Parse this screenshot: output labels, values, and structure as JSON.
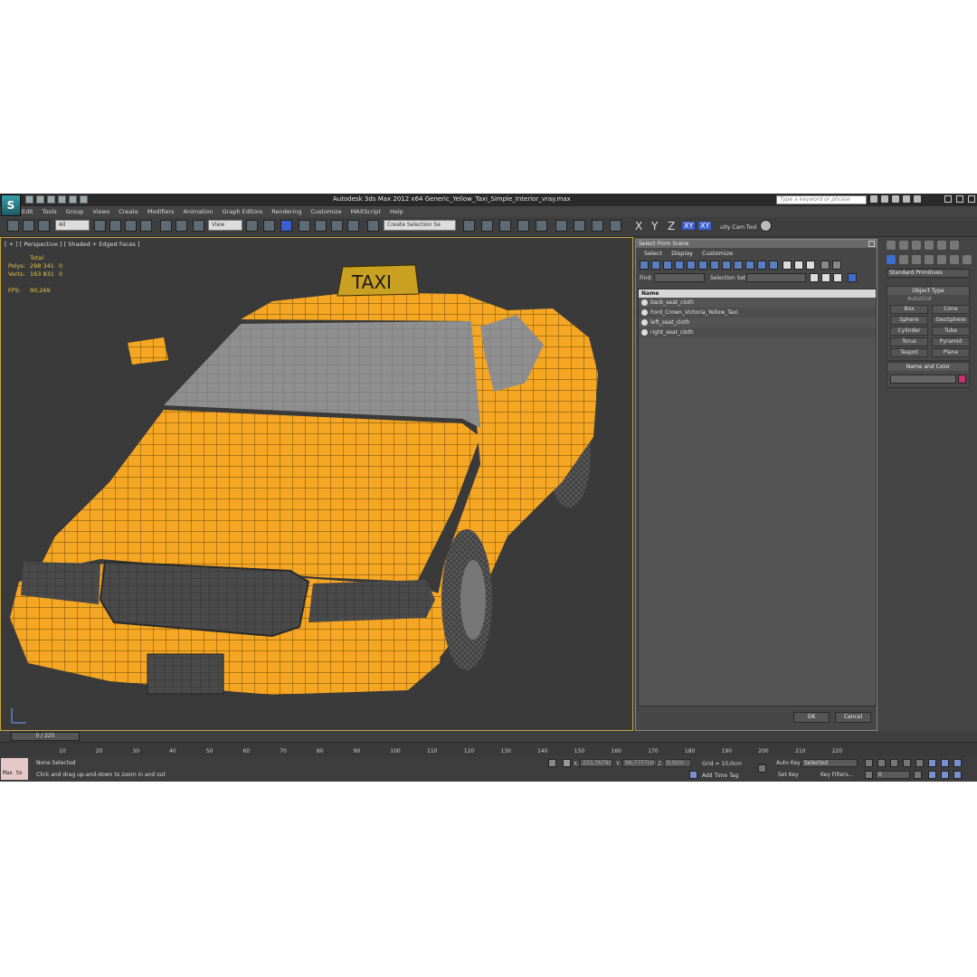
{
  "app": {
    "title": "Autodesk 3ds Max  2012 x64     Generic_Yellow_Taxi_Simple_Interior_vray.max",
    "search_placeholder": "Type a keyword or phrase"
  },
  "menu": [
    "Edit",
    "Tools",
    "Group",
    "Views",
    "Create",
    "Modifiers",
    "Animation",
    "Graph Editors",
    "Rendering",
    "Customize",
    "MAXScript",
    "Help"
  ],
  "toolbar": {
    "filter": "All",
    "ref_coord": "View",
    "selection_set": "Create Selection Se",
    "axes": [
      "X",
      "Y",
      "Z",
      "XY",
      "XY"
    ],
    "cam_tool": "uity Cam Tool"
  },
  "viewport": {
    "label": "[ + ] [ Perspective ] [ Shaded + Edged Faces ]",
    "stats": {
      "header": "Total",
      "polys_label": "Polys:",
      "polys_value": "298 341",
      "polys_sel": "0",
      "verts_label": "Verts:",
      "verts_value": "163 831",
      "verts_sel": "0",
      "fps_label": "FPS:",
      "fps_value": "90,269"
    },
    "sign_text": "TAXI",
    "body_color": "#f5a623",
    "wire_color": "#3d2a00"
  },
  "dialog": {
    "title": "Select From Scene",
    "menu": [
      "Select",
      "Display",
      "Customize"
    ],
    "find_label": "Find:",
    "selset_label": "Selection Set:",
    "column_header": "Name",
    "items": [
      "back_seat_cloth",
      "Ford_Crown_Victoria_Yellow_Taxi",
      "left_seat_cloth",
      "right_seat_cloth"
    ],
    "ok_label": "OK",
    "cancel_label": "Cancel"
  },
  "command_panel": {
    "dropdown": "Standard Primitives",
    "object_type_header": "Object Type",
    "autogrid_label": "AutoGrid",
    "primitives": [
      "Box",
      "Cone",
      "Sphere",
      "GeoSphere",
      "Cylinder",
      "Tube",
      "Torus",
      "Pyramid",
      "Teapot",
      "Plane"
    ],
    "name_color_header": "Name and Color",
    "swatch_color": "#c8326e"
  },
  "timeline": {
    "slider_label": "0 / 225",
    "ticks": [
      "10",
      "20",
      "30",
      "40",
      "50",
      "60",
      "70",
      "80",
      "90",
      "100",
      "110",
      "120",
      "130",
      "140",
      "150",
      "160",
      "170",
      "180",
      "190",
      "200",
      "210",
      "220"
    ]
  },
  "status": {
    "maxscript_label": "Max to",
    "selection_text": "None Selected",
    "prompt_text": "Click and drag up-and-down to zoom in and out",
    "x_label": "X:",
    "x_value": "225,7679c",
    "y_label": "Y:",
    "y_value": "96,7777cm",
    "z_label": "Z:",
    "z_value": "0,0cm",
    "grid_text": "Grid = 10,0cm",
    "add_time_tag": "Add Time Tag",
    "auto_key": "Auto Key",
    "set_key": "Set Key",
    "key_mode": "Selected",
    "key_filters": "Key Filters...",
    "frame_value": "0"
  }
}
